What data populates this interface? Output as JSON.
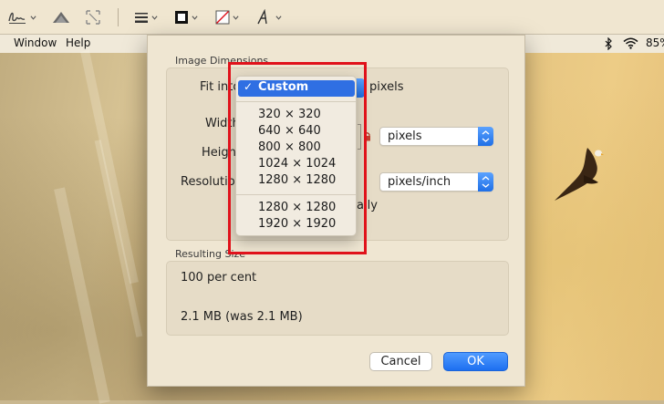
{
  "menubar": {
    "items": [
      "Window",
      "Help"
    ],
    "battery_text": "85%"
  },
  "toolbar": {
    "tools": [
      "sign-icon",
      "adjust-color-icon",
      "crop-icon",
      "shape-style-icon",
      "border-color-icon",
      "fill-color-icon",
      "text-style-icon"
    ]
  },
  "dialog": {
    "image_dimensions_title": "Image Dimensions",
    "fit_into_label": "Fit into",
    "fit_into_unit": "pixels",
    "width_label": "Width",
    "height_label": "Height",
    "resolution_label": "Resolution",
    "size_unit": "pixels",
    "resolution_unit": "pixels/inch",
    "resample_hint": "ally",
    "resulting_size_title": "Resulting Size",
    "percent_text": "100 per cent",
    "file_size_text": "2.1 MB (was 2.1 MB)",
    "cancel_label": "Cancel",
    "ok_label": "OK"
  },
  "fit_menu": {
    "selected": "Custom",
    "check": "✓",
    "group1": [
      "320 × 320",
      "640 × 640",
      "800 × 800",
      "1024 × 1024",
      "1280 × 1280"
    ],
    "group2": [
      "1280 × 1280",
      "1920 × 1920"
    ]
  },
  "colors": {
    "highlight": "#2f6fe3",
    "annotation": "#e0121b",
    "accent": "#1d6ff0"
  }
}
